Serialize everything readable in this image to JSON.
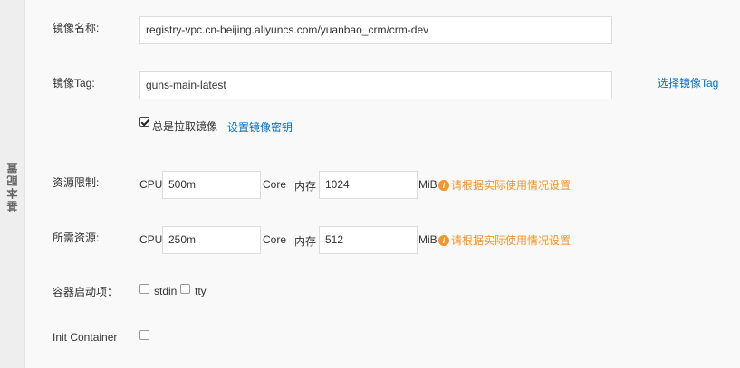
{
  "side_tab": {
    "label": "基本配置"
  },
  "image_name": {
    "label": "镜像名称:",
    "value": "registry-vpc.cn-beijing.aliyuncs.com/yuanbao_crm/crm-dev"
  },
  "image_tag": {
    "label": "镜像Tag:",
    "value": "guns-main-latest",
    "select_link": "选择镜像Tag",
    "always_pull_label": "总是拉取镜像",
    "always_pull_checked": true,
    "secret_link": "设置镜像密钥"
  },
  "resource_limit": {
    "label": "资源限制:",
    "cpu_label": "CPU",
    "cpu_value": "500m",
    "cpu_unit": "Core",
    "mem_label": "内存",
    "mem_value": "1024",
    "mem_unit": "MiB",
    "hint": "请根据实际使用情况设置"
  },
  "resource_request": {
    "label": "所需资源:",
    "cpu_label": "CPU",
    "cpu_value": "250m",
    "cpu_unit": "Core",
    "mem_label": "内存",
    "mem_value": "512",
    "mem_unit": "MiB",
    "hint": "请根据实际使用情况设置"
  },
  "startup": {
    "label": "容器启动项：",
    "stdin_label": "stdin",
    "stdin_checked": false,
    "tty_label": "tty",
    "tty_checked": false
  },
  "init_container": {
    "label": "Init Container",
    "checked": false
  },
  "colors": {
    "link": "#0070cc",
    "hint": "#f0962d",
    "panel_bg": "#f9f9f9",
    "side_bg": "#eeeeee"
  }
}
